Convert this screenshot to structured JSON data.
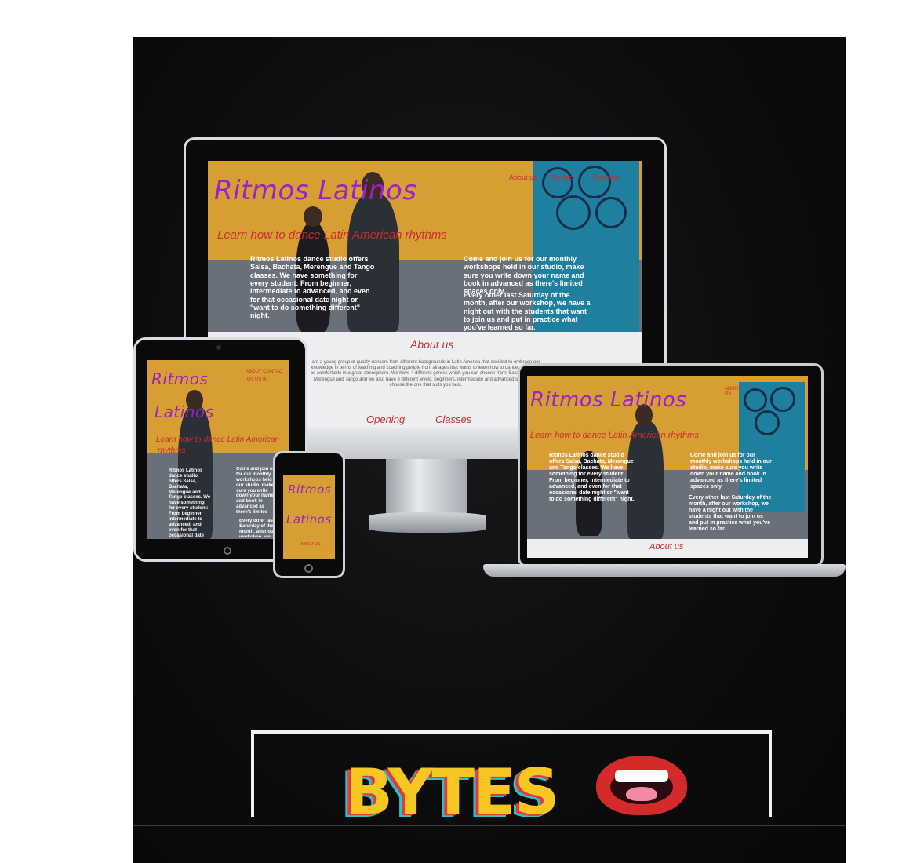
{
  "site": {
    "brand": "Ritmos Latinos",
    "brand_line1": "Ritmos",
    "brand_line2": "Latinos",
    "tagline": "Learn how to dance Latin American rhythms",
    "tagline_short_1": "Learn how to dance Latin American",
    "tagline_short_2": "rhythms",
    "nav": [
      "About us",
      "Contact",
      "Opening",
      "Classes"
    ],
    "nav_compact_1": "ABOUT CONTAC",
    "nav_compact_2": "US    US    IN",
    "nav_phone": "ABOUT US",
    "nav_laptop": "ABOUT US",
    "intro": "Ritmos Latinos dance studio offers Salsa, Bachata, Merengue and Tango classes. We have something for every student: From beginner, intermediate to advanced, and even for that occasional date night or \"want to do something different\" night.",
    "workshop_1": "Come and join us for our monthly workshops held in our studio, make sure you write down your name and book in advanced as there's limited spaces only.",
    "workshop_2": "Every other last Saturday of the month, after our workshop, we have a night out with the students that want to join us and put in practice what you've learned so far.",
    "about_title": "About us",
    "about_text": "are a young group of quality dancers from different backgrounds in Latin America that decided to embrace our knowledge in terms of teaching and coaching people from all ages that wants to learn how to dance, enjoy and be comfortable in a great atmosphere. We have 4 different genres which you can choose from: Salsa, Bachata, Merengue and Tango and we also have 3 different levels, beginners, intermediate and advanced so you can choose the one that suits you best.",
    "opening_label": "Opening",
    "classes_label": "Classes"
  },
  "branding": {
    "logo_text": "BYTES"
  },
  "colors": {
    "brand_purple": "#9b21c8",
    "accent_red": "#c72f2f",
    "hero_mustard": "#d79f33",
    "gate_teal": "#1f7f9e",
    "logo_yellow": "#f6c723"
  }
}
